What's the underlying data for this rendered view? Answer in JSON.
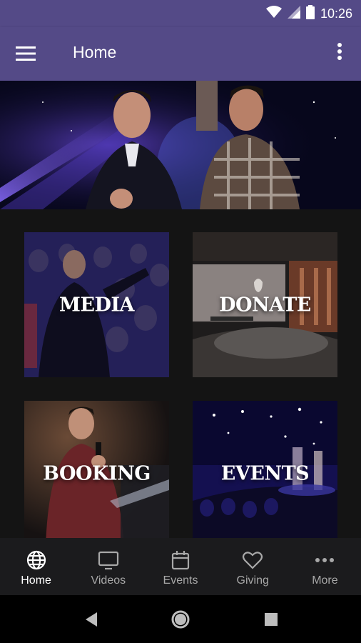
{
  "status_bar": {
    "time": "10:26",
    "icons": [
      "wifi-icon",
      "cellular-signal-icon",
      "battery-icon"
    ]
  },
  "app_bar": {
    "title": "Home",
    "left_icon": "hamburger-menu-icon",
    "right_icon": "overflow-menu-icon",
    "background": "#544a87"
  },
  "tiles": [
    {
      "label": "MEDIA"
    },
    {
      "label": "DONATE"
    },
    {
      "label": "BOOKING"
    },
    {
      "label": "EVENTS"
    }
  ],
  "bottom_nav": {
    "items": [
      {
        "label": "Home",
        "icon": "globe-icon",
        "active": true
      },
      {
        "label": "Videos",
        "icon": "tv-icon",
        "active": false
      },
      {
        "label": "Events",
        "icon": "calendar-icon",
        "active": false
      },
      {
        "label": "Giving",
        "icon": "heart-icon",
        "active": false
      },
      {
        "label": "More",
        "icon": "more-dots-icon",
        "active": false
      }
    ]
  },
  "system_nav": [
    "back-icon",
    "home-circle-icon",
    "recents-icon"
  ],
  "colors": {
    "accent": "#544a87",
    "background": "#141414",
    "nav_background": "#1b1b1d",
    "inactive_label": "#a8a8a8"
  }
}
